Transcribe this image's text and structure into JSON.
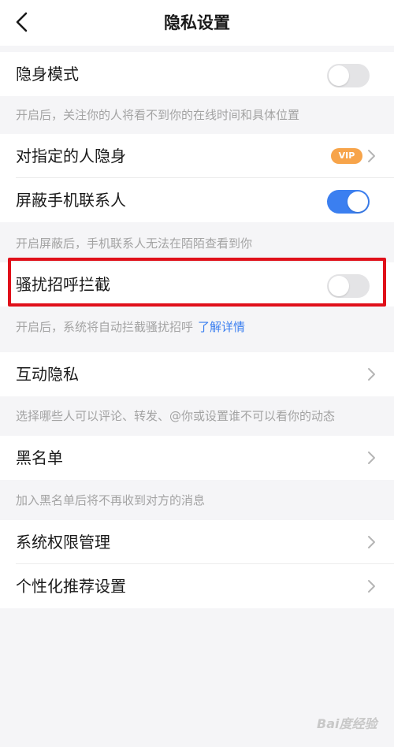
{
  "header": {
    "title": "隐私设置"
  },
  "rows": {
    "stealth": {
      "label": "隐身模式",
      "toggle_on": false
    },
    "stealth_hint": "开启后，关注你的人将看不到你的在线时间和具体位置",
    "hide_from": {
      "label": "对指定的人隐身",
      "badge": "VIP"
    },
    "block_contacts": {
      "label": "屏蔽手机联系人",
      "toggle_on": true
    },
    "block_contacts_hint": "开启屏蔽后，手机联系人无法在陌陌查看到你",
    "harass": {
      "label": "骚扰招呼拦截",
      "toggle_on": false
    },
    "harass_hint": "开启后，系统将自动拦截骚扰招呼",
    "harass_link": "了解详情",
    "interaction": {
      "label": "互动隐私"
    },
    "interaction_hint": "选择哪些人可以评论、转发、@你或设置谁不可以看你的动态",
    "blacklist": {
      "label": "黑名单"
    },
    "blacklist_hint": "加入黑名单后将不再收到对方的消息",
    "permissions": {
      "label": "系统权限管理"
    },
    "personalized": {
      "label": "个性化推荐设置"
    }
  },
  "watermark": "Bai度经验",
  "colors": {
    "accent": "#3b7ff0",
    "vip": "#f7a44a",
    "highlight": "#e0101a"
  }
}
